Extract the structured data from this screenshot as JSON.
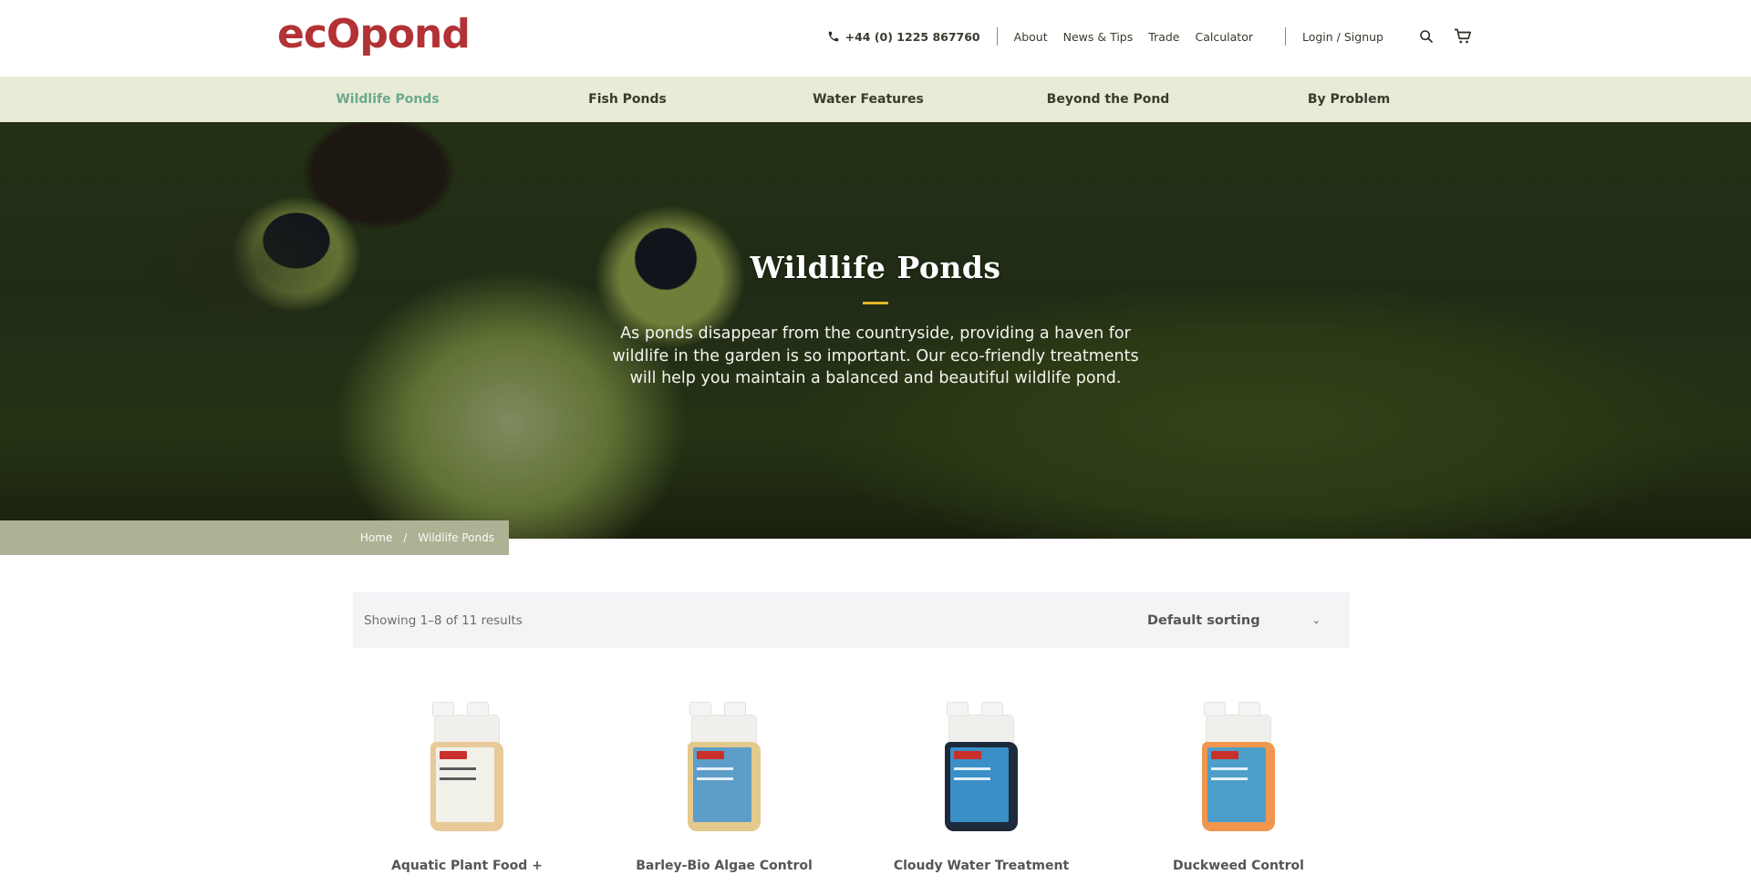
{
  "brand": {
    "logo_text": "ecOpond",
    "color": "#b23235"
  },
  "topnav": {
    "phone": "+44 (0) 1225 867760",
    "links": [
      "About",
      "News & Tips",
      "Trade",
      "Calculator"
    ],
    "login": "Login / Signup"
  },
  "mainnav": {
    "items": [
      {
        "label": "Wildlife Ponds",
        "active": true
      },
      {
        "label": "Fish Ponds",
        "active": false
      },
      {
        "label": "Water Features",
        "active": false
      },
      {
        "label": "Beyond the Pond",
        "active": false
      },
      {
        "label": "By Problem",
        "active": false
      }
    ],
    "active_color": "#6aaa8e"
  },
  "hero": {
    "title": "Wildlife Ponds",
    "description": "As ponds disappear from the countryside, providing a haven for wildlife in the garden is so important.  Our eco-friendly treatments will help you maintain a balanced and beautiful wildlife pond.",
    "accent_color": "#e1b72b"
  },
  "breadcrumb": {
    "home": "Home",
    "separator": "/",
    "current": "Wildlife Ponds"
  },
  "shop": {
    "result_count": "Showing 1–8 of 11 results",
    "sort_selected": "Default sorting"
  },
  "products": [
    {
      "name": "Aquatic Plant Food +",
      "liquid_color": "#e8c99a",
      "label_color": "#f1f1ea"
    },
    {
      "name": "Barley-Bio Algae Control",
      "liquid_color": "#e3c98c",
      "label_color": "#5d9ec8"
    },
    {
      "name": "Cloudy Water Treatment",
      "liquid_color": "#1d2a3c",
      "label_color": "#3a8fc6"
    },
    {
      "name": "Duckweed Control",
      "liquid_color": "#f0964e",
      "label_color": "#4d9fc9"
    }
  ]
}
